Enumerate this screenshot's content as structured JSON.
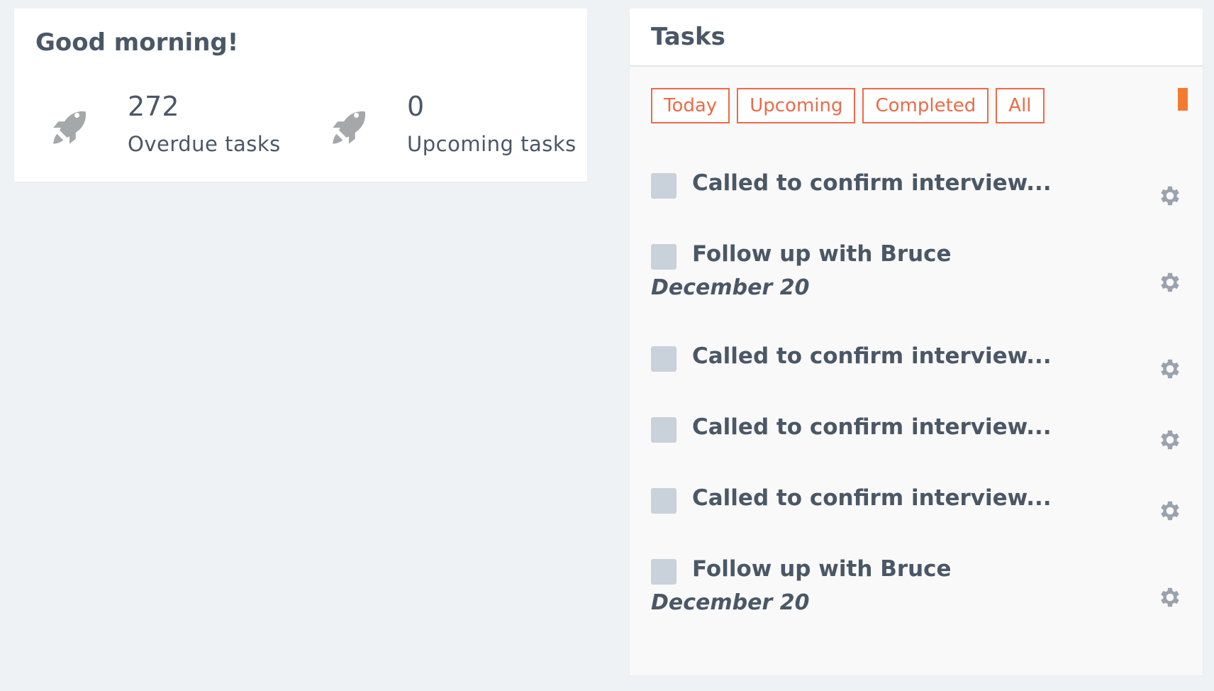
{
  "welcome": {
    "greeting": "Good morning!",
    "stats": [
      {
        "value": "272",
        "label": "Overdue tasks",
        "icon": "rocket-icon"
      },
      {
        "value": "0",
        "label": "Upcoming tasks",
        "icon": "rocket-icon"
      }
    ]
  },
  "tasks": {
    "title": "Tasks",
    "filters": [
      "Today",
      "Upcoming",
      "Completed",
      "All"
    ],
    "accent_color": "#ec6b45",
    "items": [
      {
        "title": "Called to confirm interview...",
        "date": ""
      },
      {
        "title": "Follow up with Bruce",
        "date": "December 20"
      },
      {
        "title": "Called to confirm interview...",
        "date": ""
      },
      {
        "title": "Called to confirm interview...",
        "date": ""
      },
      {
        "title": "Called to confirm interview...",
        "date": ""
      },
      {
        "title": "Follow up with Bruce",
        "date": "December 20"
      }
    ]
  }
}
